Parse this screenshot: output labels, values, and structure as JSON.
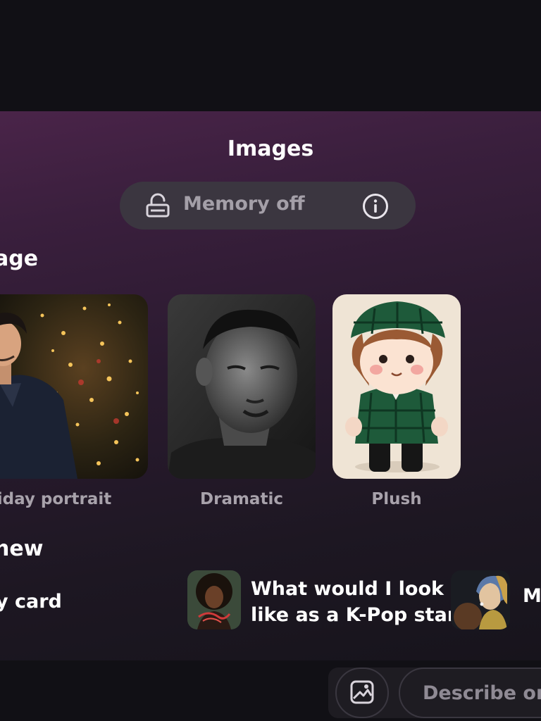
{
  "sheet": {
    "title": "Images",
    "memory": {
      "label": "Memory off",
      "lock_icon": "memory-lock-icon",
      "info_icon": "info-icon"
    }
  },
  "create_section": {
    "heading": "age",
    "cards": [
      {
        "caption": "iday portrait",
        "image": "holiday-portrait-image"
      },
      {
        "caption": "Dramatic",
        "image": "dramatic-portrait-image"
      },
      {
        "caption": "Plush",
        "image": "plush-toy-image"
      }
    ]
  },
  "new_section": {
    "heading": "new",
    "suggestions": [
      {
        "line1": "y card",
        "line2": ""
      },
      {
        "line1": "What would I look",
        "line2": "like as a K-Pop star?",
        "thumb": "afro-portrait-thumbnail"
      },
      {
        "line1": "M",
        "line2": "",
        "thumb": "pearl-earring-thumbnail"
      }
    ]
  },
  "composer": {
    "placeholder": "Describe or",
    "upload_icon": "image-upload-icon"
  },
  "colors": {
    "sheet_top": "#4a2449",
    "sheet_bottom": "#17141c",
    "pill": "#3b3640",
    "muted_text": "#a8a2ab"
  }
}
